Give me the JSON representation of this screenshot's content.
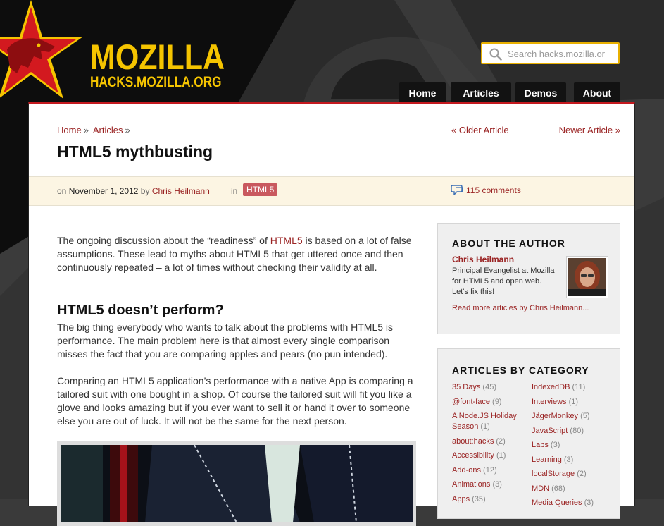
{
  "site": {
    "logo_title": "MOZILLA",
    "logo_subtitle": "HACKS.MOZILLA.ORG",
    "search_placeholder": "Search hacks.mozilla.or"
  },
  "nav": {
    "items": [
      "Home",
      "Articles",
      "Demos",
      "About"
    ]
  },
  "breadcrumb": {
    "home": "Home",
    "articles": "Articles",
    "separator": "»"
  },
  "pager": {
    "older": "« Older Article",
    "newer": "Newer Article »"
  },
  "post": {
    "title": "HTML5 mythbusting",
    "meta_on": "on",
    "date": "November 1, 2012",
    "meta_by": "by",
    "author": "Chris Heilmann",
    "meta_in": "in",
    "tag": "HTML5",
    "comments": "115 comments"
  },
  "article": {
    "p1_before": "The ongoing discussion about the “readiness” of ",
    "p1_link": "HTML5",
    "p1_after": " is based on a lot of false assumptions. These lead to myths about HTML5 that get uttered once and then continuously repeated – a lot of times without checking their validity at all.",
    "heading": "HTML5 doesn’t perform?",
    "p2": "The big thing everybody who wants to talk about the problems with HTML5 is performance. The main problem here is that almost every single comparison misses the fact that you are comparing apples and pears (no pun intended).",
    "p3": "Comparing an HTML5 application’s performance with a native App is comparing a tailored suit with one bought in a shop. Of course the tailored suit will fit you like a glove and looks amazing but if you ever want to sell it or hand it over to someone else you are out of luck. It will not be the same for the next person."
  },
  "author_box": {
    "title": "ABOUT THE AUTHOR",
    "name": "Chris Heilmann",
    "bio": "Principal Evangelist at Mozilla for HTML5 and open web. Let's fix this!",
    "more": "Read more articles by Chris Heilmann..."
  },
  "categories": {
    "title": "ARTICLES BY CATEGORY",
    "left": [
      {
        "name": "35 Days",
        "count": "(45)"
      },
      {
        "name": "@font-face",
        "count": "(9)"
      },
      {
        "name": "A Node.JS Holiday Season",
        "count": "(1)"
      },
      {
        "name": "about:hacks",
        "count": "(2)"
      },
      {
        "name": "Accessibility",
        "count": "(1)"
      },
      {
        "name": "Add-ons",
        "count": "(12)"
      },
      {
        "name": "Animations",
        "count": "(3)"
      },
      {
        "name": "Apps",
        "count": "(35)"
      }
    ],
    "right": [
      {
        "name": "IndexedDB",
        "count": "(11)"
      },
      {
        "name": "Interviews",
        "count": "(1)"
      },
      {
        "name": "JägerMonkey",
        "count": "(5)"
      },
      {
        "name": "JavaScript",
        "count": "(80)"
      },
      {
        "name": "Labs",
        "count": "(3)"
      },
      {
        "name": "Learning",
        "count": "(3)"
      },
      {
        "name": "localStorage",
        "count": "(2)"
      },
      {
        "name": "MDN",
        "count": "(68)"
      },
      {
        "name": "Media Queries",
        "count": "(3)"
      }
    ]
  },
  "colors": {
    "accent_red": "#c4191f",
    "logo_yellow": "#f5c400",
    "link": "#9a2323",
    "meta_bg": "#fcf5e3"
  }
}
